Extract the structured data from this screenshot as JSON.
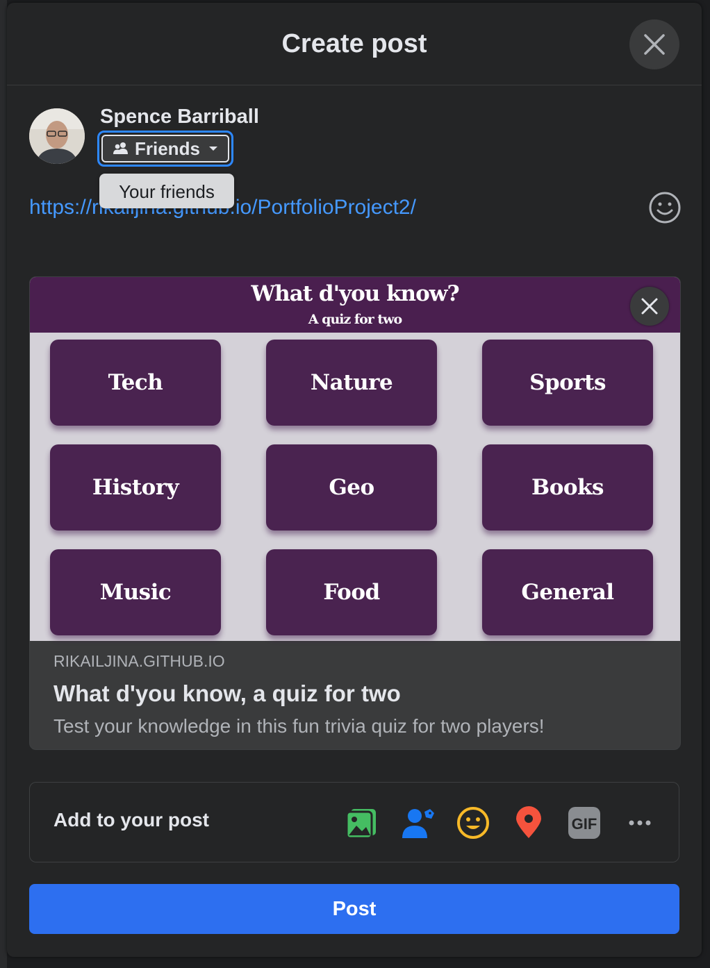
{
  "modal": {
    "title": "Create post",
    "close_icon": "close-icon"
  },
  "user": {
    "name": "Spence Barriball",
    "audience_label": "Friends",
    "audience_icon": "friends-icon",
    "audience_tooltip": "Your friends"
  },
  "composer": {
    "text": "https://rikailjina.github.io/PortfolioProject2/",
    "emoji_icon": "smiley-icon"
  },
  "link_preview": {
    "image": {
      "title": "What d'you know?",
      "subtitle": "A quiz for two",
      "categories": [
        "Tech",
        "Nature",
        "Sports",
        "History",
        "Geo",
        "Books",
        "Music",
        "Food",
        "General"
      ]
    },
    "domain": "RIKAILJINA.GITHUB.IO",
    "title": "What d'you know, a quiz for two",
    "description": "Test your knowledge in this fun trivia quiz for two players!"
  },
  "add_to_post": {
    "label": "Add to your post",
    "icons": [
      "photo-video-icon",
      "tag-people-icon",
      "feeling-icon",
      "check-in-icon",
      "gif-icon",
      "more-icon"
    ],
    "gif_text": "GIF"
  },
  "post_button": "Post",
  "colors": {
    "accent": "#2d6ff0",
    "link": "#4599ff",
    "quiz_purple": "#4a2350"
  }
}
